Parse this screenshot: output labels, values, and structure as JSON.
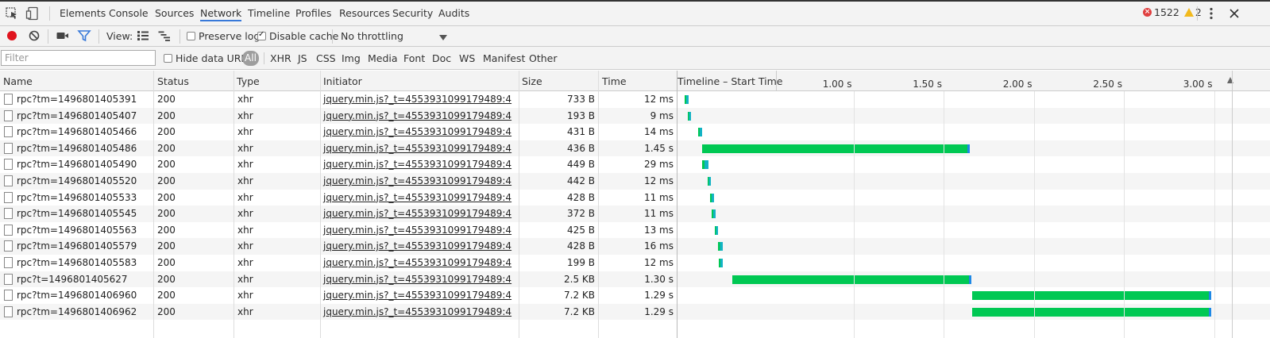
{
  "tabs": [
    {
      "label": "Elements"
    },
    {
      "label": "Console"
    },
    {
      "label": "Sources"
    },
    {
      "label": "Network"
    },
    {
      "label": "Timeline"
    },
    {
      "label": "Profiles"
    },
    {
      "label": "Resources"
    },
    {
      "label": "Security"
    },
    {
      "label": "Audits"
    }
  ],
  "active_tab": "Network",
  "errors": {
    "count": "1522",
    "warnings": "2"
  },
  "toolbar": {
    "view_label": "View:",
    "preserve_log_label": "Preserve log",
    "preserve_log_checked": false,
    "disable_cache_label": "Disable cache",
    "disable_cache_checked": true,
    "throttling": "No throttling"
  },
  "filter": {
    "placeholder": "Filter",
    "hide_data_urls_label": "Hide data URLs",
    "hide_data_urls_checked": false,
    "types": [
      "All",
      "XHR",
      "JS",
      "CSS",
      "Img",
      "Media",
      "Font",
      "Doc",
      "WS",
      "Manifest",
      "Other"
    ],
    "active_type": "All"
  },
  "columns": {
    "name": "Name",
    "status": "Status",
    "type": "Type",
    "initiator": "Initiator",
    "size": "Size",
    "time": "Time",
    "timeline": "Timeline – Start Time"
  },
  "timeline": {
    "ticks": [
      "1.00 s",
      "1.50 s",
      "2.00 s",
      "2.50 s",
      "3.00 s"
    ],
    "tick_seconds": [
      1.0,
      1.5,
      2.0,
      2.5,
      3.0
    ],
    "waiting_color": "#00c853",
    "download_color": "#1e88e5",
    "short_color": "#12b3c4"
  },
  "rows": [
    {
      "name": "rpc?tm=1496801405391",
      "status": "200",
      "type": "xhr",
      "initiator": "jquery.min.js?_t=4553931099179489:4",
      "size": "733 B",
      "time": "12 ms",
      "start_s": 0.065,
      "end_s": 0.085
    },
    {
      "name": "rpc?tm=1496801405407",
      "status": "200",
      "type": "xhr",
      "initiator": "jquery.min.js?_t=4553931099179489:4",
      "size": "193 B",
      "time": "9 ms",
      "start_s": 0.08,
      "end_s": 0.095
    },
    {
      "name": "rpc?tm=1496801405466",
      "status": "200",
      "type": "xhr",
      "initiator": "jquery.min.js?_t=4553931099179489:4",
      "size": "431 B",
      "time": "14 ms",
      "start_s": 0.14,
      "end_s": 0.16
    },
    {
      "name": "rpc?tm=1496801405486",
      "status": "200",
      "type": "xhr",
      "initiator": "jquery.min.js?_t=4553931099179489:4",
      "size": "436 B",
      "time": "1.45 s",
      "start_s": 0.16,
      "end_s": 1.645
    },
    {
      "name": "rpc?tm=1496801405490",
      "status": "200",
      "type": "xhr",
      "initiator": "jquery.min.js?_t=4553931099179489:4",
      "size": "449 B",
      "time": "29 ms",
      "start_s": 0.16,
      "end_s": 0.195
    },
    {
      "name": "rpc?tm=1496801405520",
      "status": "200",
      "type": "xhr",
      "initiator": "jquery.min.js?_t=4553931099179489:4",
      "size": "442 B",
      "time": "12 ms",
      "start_s": 0.19,
      "end_s": 0.21
    },
    {
      "name": "rpc?tm=1496801405533",
      "status": "200",
      "type": "xhr",
      "initiator": "jquery.min.js?_t=4553931099179489:4",
      "size": "428 B",
      "time": "11 ms",
      "start_s": 0.205,
      "end_s": 0.225
    },
    {
      "name": "rpc?tm=1496801405545",
      "status": "200",
      "type": "xhr",
      "initiator": "jquery.min.js?_t=4553931099179489:4",
      "size": "372 B",
      "time": "11 ms",
      "start_s": 0.215,
      "end_s": 0.235
    },
    {
      "name": "rpc?tm=1496801405563",
      "status": "200",
      "type": "xhr",
      "initiator": "jquery.min.js?_t=4553931099179489:4",
      "size": "425 B",
      "time": "13 ms",
      "start_s": 0.23,
      "end_s": 0.25
    },
    {
      "name": "rpc?tm=1496801405579",
      "status": "200",
      "type": "xhr",
      "initiator": "jquery.min.js?_t=4553931099179489:4",
      "size": "428 B",
      "time": "16 ms",
      "start_s": 0.25,
      "end_s": 0.275
    },
    {
      "name": "rpc?tm=1496801405583",
      "status": "200",
      "type": "xhr",
      "initiator": "jquery.min.js?_t=4553931099179489:4",
      "size": "199 B",
      "time": "12 ms",
      "start_s": 0.255,
      "end_s": 0.275
    },
    {
      "name": "rpc?t=1496801405627",
      "status": "200",
      "type": "xhr",
      "initiator": "jquery.min.js?_t=4553931099179489:4",
      "size": "2.5 KB",
      "time": "1.30 s",
      "start_s": 0.33,
      "end_s": 1.655
    },
    {
      "name": "rpc?tm=1496801406960",
      "status": "200",
      "type": "xhr",
      "initiator": "jquery.min.js?_t=4553931099179489:4",
      "size": "7.2 KB",
      "time": "1.29 s",
      "start_s": 1.66,
      "end_s": 2.985
    },
    {
      "name": "rpc?tm=1496801406962",
      "status": "200",
      "type": "xhr",
      "initiator": "jquery.min.js?_t=4553931099179489:4",
      "size": "7.2 KB",
      "time": "1.29 s",
      "start_s": 1.66,
      "end_s": 2.985
    }
  ]
}
